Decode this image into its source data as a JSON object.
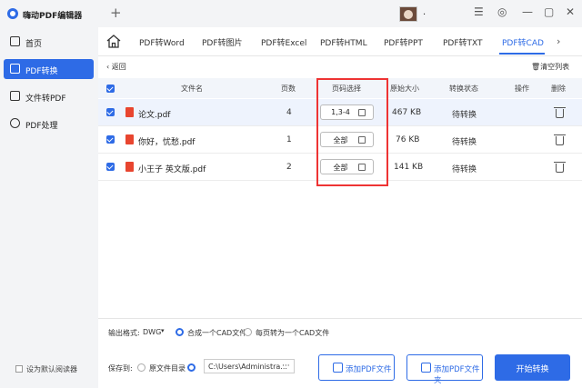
{
  "app": {
    "title": "嗨动PDF编辑器",
    "user": "."
  },
  "sidebar": {
    "items": [
      {
        "label": "首页",
        "icon": "monitor-icon"
      },
      {
        "label": "PDF转换",
        "icon": "document-icon"
      },
      {
        "label": "文件转PDF",
        "icon": "image-file-icon"
      },
      {
        "label": "PDF处理",
        "icon": "settings-icon"
      }
    ],
    "default_reader": "设为默认阅读器"
  },
  "tabs": [
    "PDF转Word",
    "PDF转图片",
    "PDF转Excel",
    "PDF转HTML",
    "PDF转PPT",
    "PDF转TXT",
    "PDF转CAD"
  ],
  "toolbar": {
    "back": "返回",
    "clear": "清空列表"
  },
  "table": {
    "headers": {
      "filename": "文件名",
      "pages": "页数",
      "page_select": "页码选择",
      "size": "原始大小",
      "status": "转换状态",
      "action": "操作",
      "delete": "删除"
    },
    "rows": [
      {
        "name": "论文.pdf",
        "pages": "4",
        "range": "1,3-4",
        "size": "467 KB",
        "status": "待转换"
      },
      {
        "name": "你好，忧愁.pdf",
        "pages": "1",
        "range": "全部",
        "size": "76 KB",
        "status": "待转换"
      },
      {
        "name": "小王子 英文版.pdf",
        "pages": "2",
        "range": "全部",
        "size": "141 KB",
        "status": "待转换"
      }
    ]
  },
  "output": {
    "format_label": "输出格式:",
    "format_value": "DWG",
    "option_merge": "合成一个CAD文件",
    "option_each": "每页转为一个CAD文件",
    "save_label": "保存到:",
    "save_original": "原文件目录",
    "path": "C:\\Users\\Administra..."
  },
  "buttons": {
    "add_file": "添加PDF文件",
    "add_folder": "添加PDF文件夹",
    "start": "开始转换"
  },
  "colors": {
    "accent": "#2e6be6",
    "highlight_box": "#ee3333",
    "pdf_icon": "#e8452f"
  }
}
